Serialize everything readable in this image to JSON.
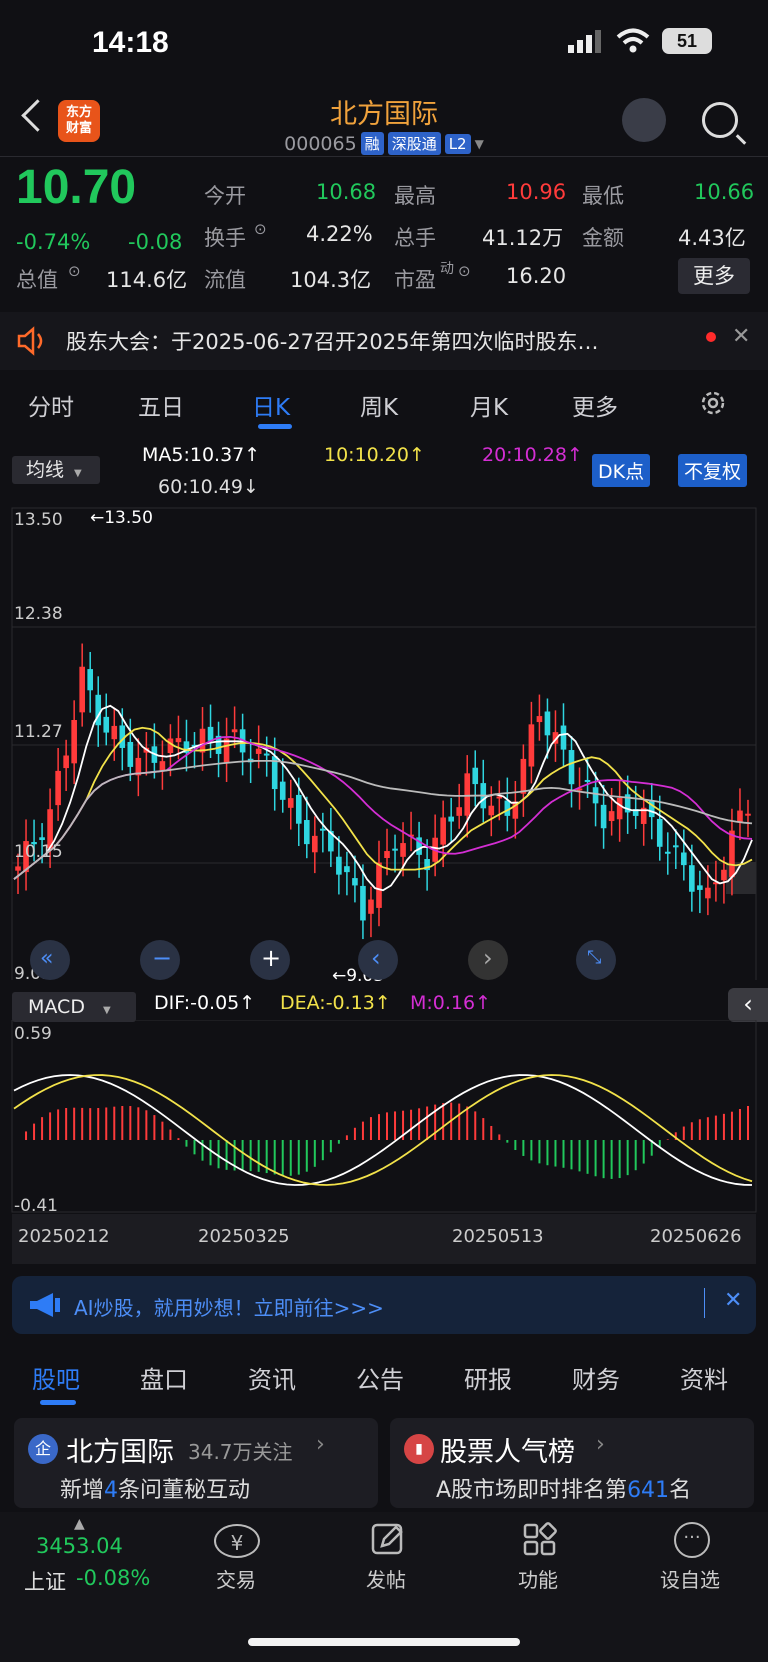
{
  "status": {
    "time": "14:18",
    "battery": "51"
  },
  "header": {
    "logo_text_1": "东方",
    "logo_text_2": "财富",
    "title": "北方国际",
    "code": "000065",
    "tags": [
      "融",
      "深股通",
      "L2"
    ]
  },
  "quote": {
    "price": "10.70",
    "change_pct": "-0.74%",
    "change": "-0.08",
    "open_label": "今开",
    "open": "10.68",
    "high_label": "最高",
    "high": "10.96",
    "low_label": "最低",
    "low": "10.66",
    "turnover_label": "换手",
    "turnover": "4.22%",
    "volume_label": "总手",
    "volume": "41.12万",
    "amount_label": "金额",
    "amount": "4.43亿",
    "mcap_label": "总值",
    "mcap": "114.6亿",
    "float_label": "流值",
    "float_cap": "104.3亿",
    "pe_label": "市盈",
    "pe_sup": "动",
    "pe": "16.20",
    "more": "更多"
  },
  "notice": {
    "text": "股东大会：于2025-06-27召开2025年第四次临时股东…"
  },
  "tabs": {
    "items": [
      "分时",
      "五日",
      "日K",
      "周K",
      "月K",
      "更多"
    ],
    "active": 2
  },
  "ma": {
    "select": "均线",
    "ma5": "MA5:10.37",
    "ma10": "10:10.20",
    "ma20": "20:10.28",
    "ma60": "60:10.49",
    "dk": "DK点",
    "fq": "不复权"
  },
  "kline": {
    "ymax": "13.50",
    "y2": "12.38",
    "y3": "11.27",
    "y4": "10.15",
    "ymin": "9.03",
    "max_arrow": "←13.50",
    "min_arrow": "←9.03"
  },
  "macd": {
    "select": "MACD",
    "dif": "DIF:-0.05",
    "dea": "DEA:-0.13",
    "m": "M:0.16",
    "ymax": "0.59",
    "ymin": "-0.41"
  },
  "dates": [
    "20250212",
    "20250325",
    "20250513",
    "20250626"
  ],
  "ai": {
    "text": "AI炒股，就用妙想！立即前往>>>"
  },
  "bottom_tabs": [
    "股吧",
    "盘口",
    "资讯",
    "公告",
    "研报",
    "财务",
    "资料"
  ],
  "cards": {
    "left_title": "北方国际",
    "left_follow": "34.7万关注",
    "left_sub_a": "新增",
    "left_sub_num": "4",
    "left_sub_b": "条问董秘互动",
    "right_title": "股票人气榜",
    "right_sub_a": "A股市场即时排名第",
    "right_sub_num": "641",
    "right_sub_b": "名"
  },
  "nav": {
    "index_value": "3453.04",
    "index_name": "上证",
    "index_change": "-0.08%",
    "items": [
      "交易",
      "发帖",
      "功能",
      "设自选"
    ]
  },
  "colors": {
    "up": "#ff3b3b",
    "down": "#21c85c",
    "accent": "#2e7cf6",
    "ma5": "#ffffff",
    "ma10": "#f2e24a",
    "ma20": "#d42ed4",
    "ma60": "#bbbbbb"
  }
}
